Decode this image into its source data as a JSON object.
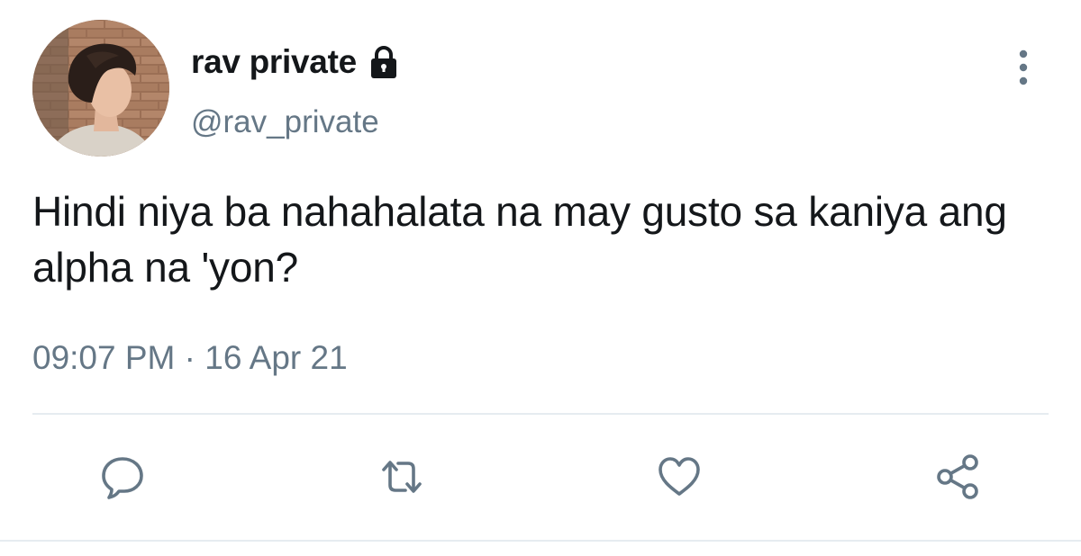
{
  "user": {
    "display_name": "rav private",
    "handle": "@rav_private",
    "avatar_icon": "profile-photo",
    "protected_icon": "lock-icon"
  },
  "tweet": {
    "text": "Hindi niya ba nahahalata na may gusto sa kaniya ang alpha na 'yon?",
    "time": "09:07 PM",
    "separator": " · ",
    "date": "16 Apr 21"
  },
  "actions": [
    {
      "name": "reply",
      "icon": "comment-icon"
    },
    {
      "name": "retweet",
      "icon": "retweet-icon"
    },
    {
      "name": "like",
      "icon": "heart-icon"
    },
    {
      "name": "share",
      "icon": "share-icon"
    }
  ],
  "colors": {
    "primary_text": "#14171a",
    "secondary_text": "#657786",
    "icon": "#657786",
    "divider": "#e6ecf0"
  }
}
